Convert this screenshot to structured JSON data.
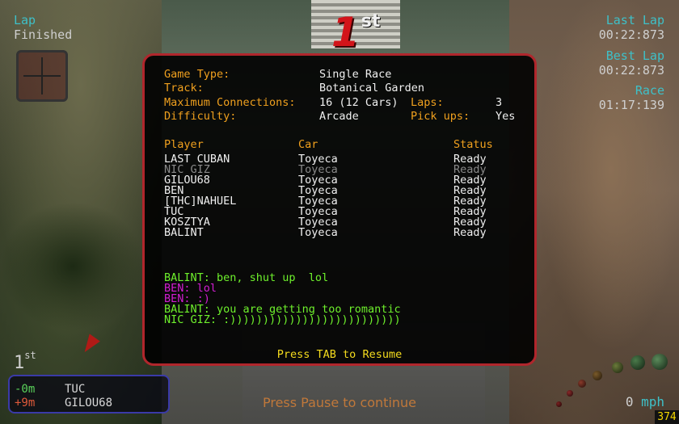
{
  "hud": {
    "lap_label": "Lap",
    "lap_status": "Finished",
    "last_lap_label": "Last Lap",
    "last_lap_time": "00:22:873",
    "best_lap_label": "Best Lap",
    "best_lap_time": "00:22:873",
    "race_label": "Race",
    "race_time": "01:17:139",
    "place_top_number": "1",
    "place_top_suffix": "st",
    "place_bottom_number": "1",
    "place_bottom_suffix": "st",
    "speed_value": "0",
    "speed_unit": "mph",
    "odometer": "374",
    "pause_message": "Press Pause to continue"
  },
  "standings": [
    {
      "gap": "-0m",
      "name": "TUC"
    },
    {
      "gap": "+9m",
      "name": "GILOU68"
    }
  ],
  "game_info": {
    "game_type_label": "Game Type:",
    "game_type": "Single Race",
    "track_label": "Track:",
    "track": "Botanical Garden",
    "max_conn_label": "Maximum Connections:",
    "max_conn": "16 (12 Cars)",
    "laps_label": "Laps:",
    "laps": "3",
    "difficulty_label": "Difficulty:",
    "difficulty": "Arcade",
    "pickups_label": "Pick ups:",
    "pickups": "Yes"
  },
  "player_table": {
    "headers": [
      "Player",
      "Car",
      "Status"
    ],
    "rows": [
      {
        "player": "LAST CUBAN",
        "car": "Toyeca",
        "status": "Ready"
      },
      {
        "player": "NIC GIZ",
        "car": "Toyeca",
        "status": "Ready"
      },
      {
        "player": "GILOU68",
        "car": "Toyeca",
        "status": "Ready"
      },
      {
        "player": "BEN",
        "car": "Toyeca",
        "status": "Ready"
      },
      {
        "player": "[THC]NAHUEL",
        "car": "Toyeca",
        "status": "Ready"
      },
      {
        "player": "TUC",
        "car": "Toyeca",
        "status": "Ready"
      },
      {
        "player": "KOSZTYA",
        "car": "Toyeca",
        "status": "Ready"
      },
      {
        "player": "BALINT",
        "car": "Toyeca",
        "status": "Ready"
      }
    ]
  },
  "chat": [
    {
      "text": "BALINT: ben, shut up  lol",
      "color": "#6ef02c"
    },
    {
      "text": "BEN: lol",
      "color": "#d21ed2"
    },
    {
      "text": "BEN: :)",
      "color": "#d21ed2"
    },
    {
      "text": "BALINT: you are getting too romantic",
      "color": "#6ef02c"
    },
    {
      "text": "NIC GIZ: :))))))))))))))))))))))))))",
      "color": "#6ef02c"
    }
  ],
  "resume_hint": "Press TAB to Resume",
  "colors": {
    "dialog_border": "#b0262c",
    "label_orange": "#f0a01e",
    "hud_cyan": "#3ec0c8",
    "place_red": "#d2141a"
  }
}
